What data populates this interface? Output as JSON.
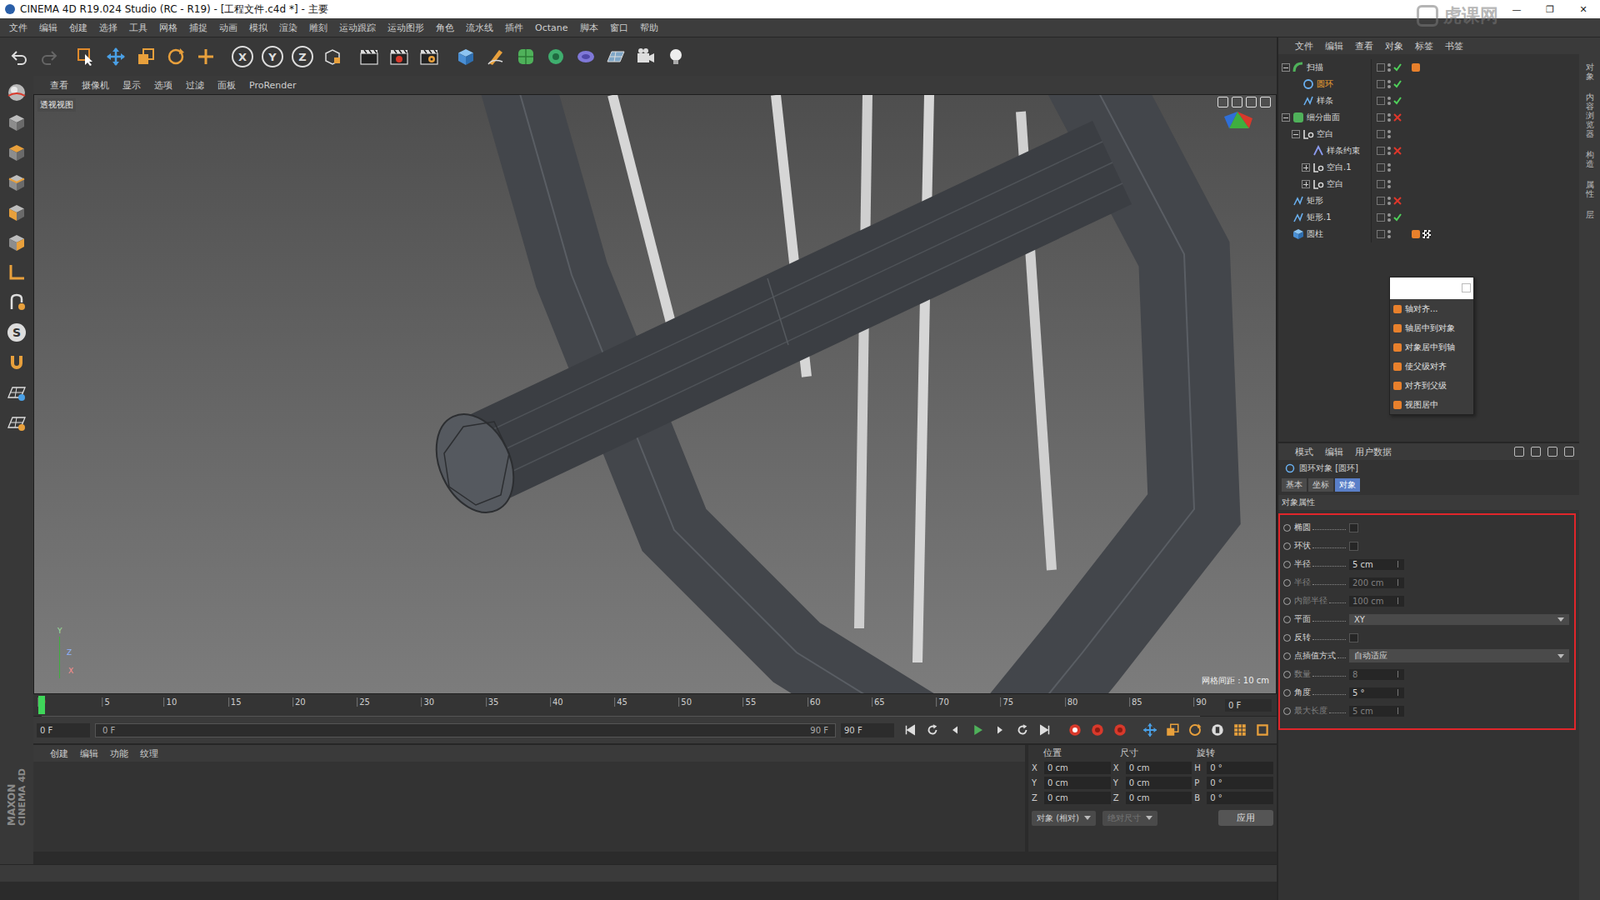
{
  "window": {
    "title": "CINEMA 4D R19.024 Studio (RC - R19) - [工程文件.c4d *] - 主要",
    "controls": [
      "—",
      "❐",
      "✕"
    ]
  },
  "watermark": "虎课网",
  "menu": [
    "文件",
    "编辑",
    "创建",
    "选择",
    "工具",
    "网格",
    "捕捉",
    "动画",
    "模拟",
    "渲染",
    "雕刻",
    "运动跟踪",
    "运动图形",
    "角色",
    "流水线",
    "插件",
    "Octane",
    "脚本",
    "窗口",
    "帮助"
  ],
  "toolbar": {
    "axis_buttons": [
      "X",
      "Y",
      "Z"
    ]
  },
  "left_tools": {
    "glyph": "S"
  },
  "logo": [
    "MAXON",
    "CINEMA 4D"
  ],
  "viewport": {
    "menu": [
      "查看",
      "摄像机",
      "显示",
      "选项",
      "过滤",
      "面板",
      "ProRender"
    ],
    "label": "透视视图",
    "grid": "网格间距 : 10 cm",
    "axes": [
      "Y",
      "Z",
      "X"
    ]
  },
  "timeline": {
    "ticks": [
      "0",
      "5",
      "10",
      "15",
      "20",
      "25",
      "30",
      "35",
      "40",
      "45",
      "50",
      "55",
      "60",
      "65",
      "70",
      "75",
      "80",
      "85",
      "90"
    ],
    "end_label": "0 F",
    "position": 0
  },
  "playback": {
    "start": "0 F",
    "range_start": "0 F",
    "range_end": "90 F",
    "end": "90 F"
  },
  "material_menu": [
    "创建",
    "编辑",
    "功能",
    "纹理"
  ],
  "coords": {
    "headers": [
      "位置",
      "尺寸",
      "旋转"
    ],
    "rows": [
      {
        "axis": "X",
        "pos": "0 cm",
        "size_axis": "X",
        "size": "0 cm",
        "rot_axis": "H",
        "rot": "0 °"
      },
      {
        "axis": "Y",
        "pos": "0 cm",
        "size_axis": "Y",
        "size": "0 cm",
        "rot_axis": "P",
        "rot": "0 °"
      },
      {
        "axis": "Z",
        "pos": "0 cm",
        "size_axis": "Z",
        "size": "0 cm",
        "rot_axis": "B",
        "rot": "0 °"
      }
    ],
    "mode": "对象 (相对)",
    "size_mode": "绝对尺寸",
    "size_mode_disabled": true,
    "apply": "应用"
  },
  "object_manager": {
    "menu": [
      "文件",
      "编辑",
      "查看",
      "对象",
      "标签",
      "书签"
    ],
    "objects": [
      {
        "name": "扫描",
        "depth": 0,
        "kind": "sweep",
        "expandable": true,
        "expanded": true,
        "state": "on",
        "selected": false,
        "tags": [
          "orange"
        ]
      },
      {
        "name": "圆环",
        "depth": 1,
        "kind": "circle",
        "expandable": false,
        "expanded": false,
        "state": "on",
        "selected": true,
        "tags": []
      },
      {
        "name": "样条",
        "depth": 1,
        "kind": "spline",
        "expandable": false,
        "expanded": false,
        "state": "on",
        "selected": false,
        "tags": []
      },
      {
        "name": "细分曲面",
        "depth": 0,
        "kind": "subdiv",
        "expandable": true,
        "expanded": true,
        "state": "off",
        "selected": false,
        "tags": []
      },
      {
        "name": "空白",
        "depth": 1,
        "kind": "null",
        "expandable": true,
        "expanded": true,
        "state": "none",
        "selected": false,
        "tags": []
      },
      {
        "name": "样条约束",
        "depth": 2,
        "kind": "deformer",
        "expandable": false,
        "expanded": false,
        "state": "off",
        "selected": false,
        "tags": []
      },
      {
        "name": "空白.1",
        "depth": 2,
        "kind": "null",
        "expandable": true,
        "expanded": false,
        "state": "none",
        "selected": false,
        "tags": []
      },
      {
        "name": "空白",
        "depth": 2,
        "kind": "null",
        "expandable": true,
        "expanded": false,
        "state": "none",
        "selected": false,
        "tags": []
      },
      {
        "name": "矩形",
        "depth": 0,
        "kind": "spline",
        "expandable": false,
        "expanded": false,
        "state": "off",
        "selected": false,
        "tags": []
      },
      {
        "name": "矩形.1",
        "depth": 0,
        "kind": "spline",
        "expandable": false,
        "expanded": false,
        "state": "on",
        "selected": false,
        "tags": []
      },
      {
        "name": "圆柱",
        "depth": 0,
        "kind": "cylinder",
        "expandable": false,
        "expanded": false,
        "state": "none",
        "selected": false,
        "tags": [
          "orange",
          "checker"
        ]
      }
    ]
  },
  "context_menu": {
    "input": "",
    "items": [
      "轴对齐...",
      "轴居中到对象",
      "对象居中到轴",
      "使父级对齐",
      "对齐到父级",
      "视图居中"
    ]
  },
  "attributes": {
    "menu": [
      "模式",
      "编辑",
      "用户数据"
    ],
    "title": "圆环对象 [圆环]",
    "tabs": [
      {
        "label": "基本",
        "selected": false
      },
      {
        "label": "坐标",
        "selected": false
      },
      {
        "label": "对象",
        "selected": true
      }
    ],
    "section": "对象属性",
    "highlighted": true,
    "props": [
      {
        "kind": "checkbox",
        "label": "椭圆",
        "checked": false,
        "disabled": false
      },
      {
        "kind": "checkbox",
        "label": "环状",
        "checked": false,
        "disabled": false
      },
      {
        "kind": "number",
        "label": "半径",
        "value": "5 cm",
        "disabled": false
      },
      {
        "kind": "number",
        "label": "半径",
        "value": "200 cm",
        "disabled": true
      },
      {
        "kind": "number",
        "label": "内部半径",
        "value": "100 cm",
        "disabled": true
      },
      {
        "kind": "dropdown",
        "label": "平面",
        "value": "XY",
        "disabled": false
      },
      {
        "kind": "checkbox",
        "label": "反转",
        "checked": false,
        "disabled": false
      },
      {
        "kind": "dropdown",
        "label": "点插值方式",
        "value": "自动适应",
        "disabled": false
      },
      {
        "kind": "number",
        "label": "数量",
        "value": "8",
        "disabled": true
      },
      {
        "kind": "number",
        "label": "角度",
        "value": "5 °",
        "disabled": false
      },
      {
        "kind": "number",
        "label": "最大长度",
        "value": "5 cm",
        "disabled": true
      }
    ]
  },
  "side_tabs": [
    "对象",
    "内容浏览器",
    "构造",
    "属性",
    "层"
  ]
}
